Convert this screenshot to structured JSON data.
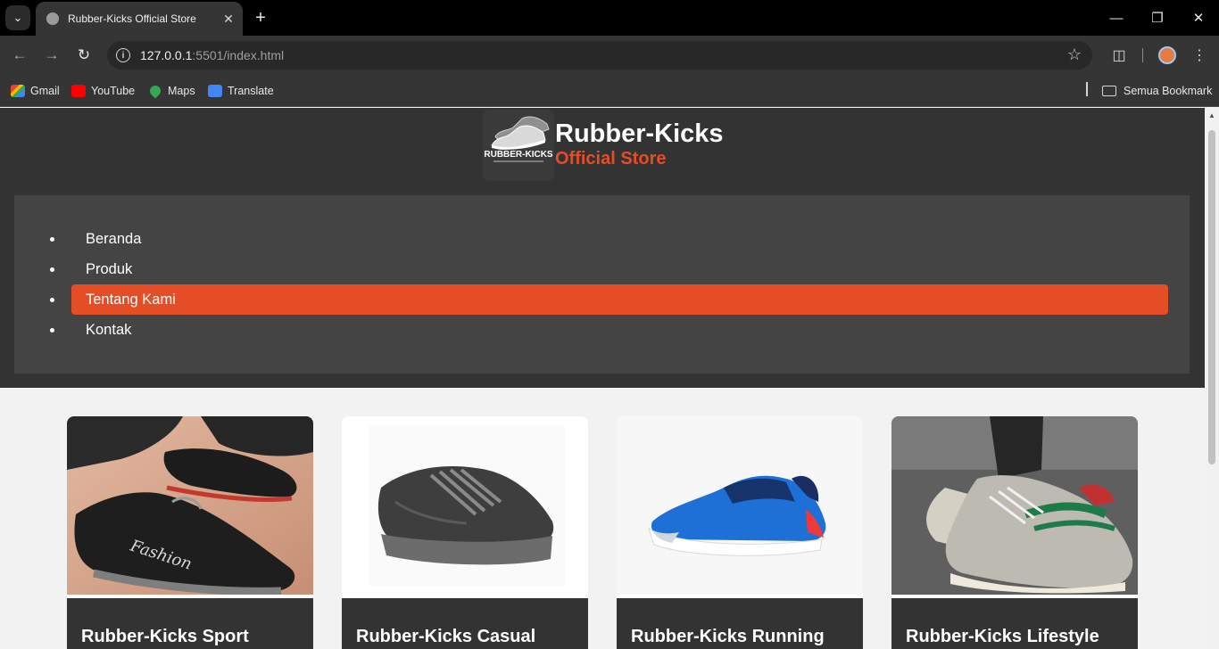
{
  "browser": {
    "tab_title": "Rubber-Kicks Official Store",
    "url_host": "127.0.0.1",
    "url_path": ":5501/index.html",
    "bookmarks": [
      {
        "label": "Gmail"
      },
      {
        "label": "YouTube"
      },
      {
        "label": "Maps"
      },
      {
        "label": "Translate"
      }
    ],
    "all_bookmarks_label": "Semua Bookmark"
  },
  "site": {
    "brand_name": "Rubber-Kicks",
    "brand_tagline": "Official Store",
    "logo_text": "RUBBER-KICKS",
    "accent_color": "#e44d26",
    "nav": [
      {
        "label": "Beranda",
        "active": false
      },
      {
        "label": "Produk",
        "active": false
      },
      {
        "label": "Tentang Kami",
        "active": true
      },
      {
        "label": "Kontak",
        "active": false
      }
    ]
  },
  "products": [
    {
      "title": "Rubber-Kicks Sport",
      "image": "black-knit-slip-on-shoe-with-fashion-print"
    },
    {
      "title": "Rubber-Kicks Casual",
      "image": "dark-grey-leather-sneaker"
    },
    {
      "title": "Rubber-Kicks Running",
      "image": "blue-kids-running-shoe"
    },
    {
      "title": "Rubber-Kicks Lifestyle",
      "image": "grey-green-retro-sneaker-on-feet"
    }
  ]
}
